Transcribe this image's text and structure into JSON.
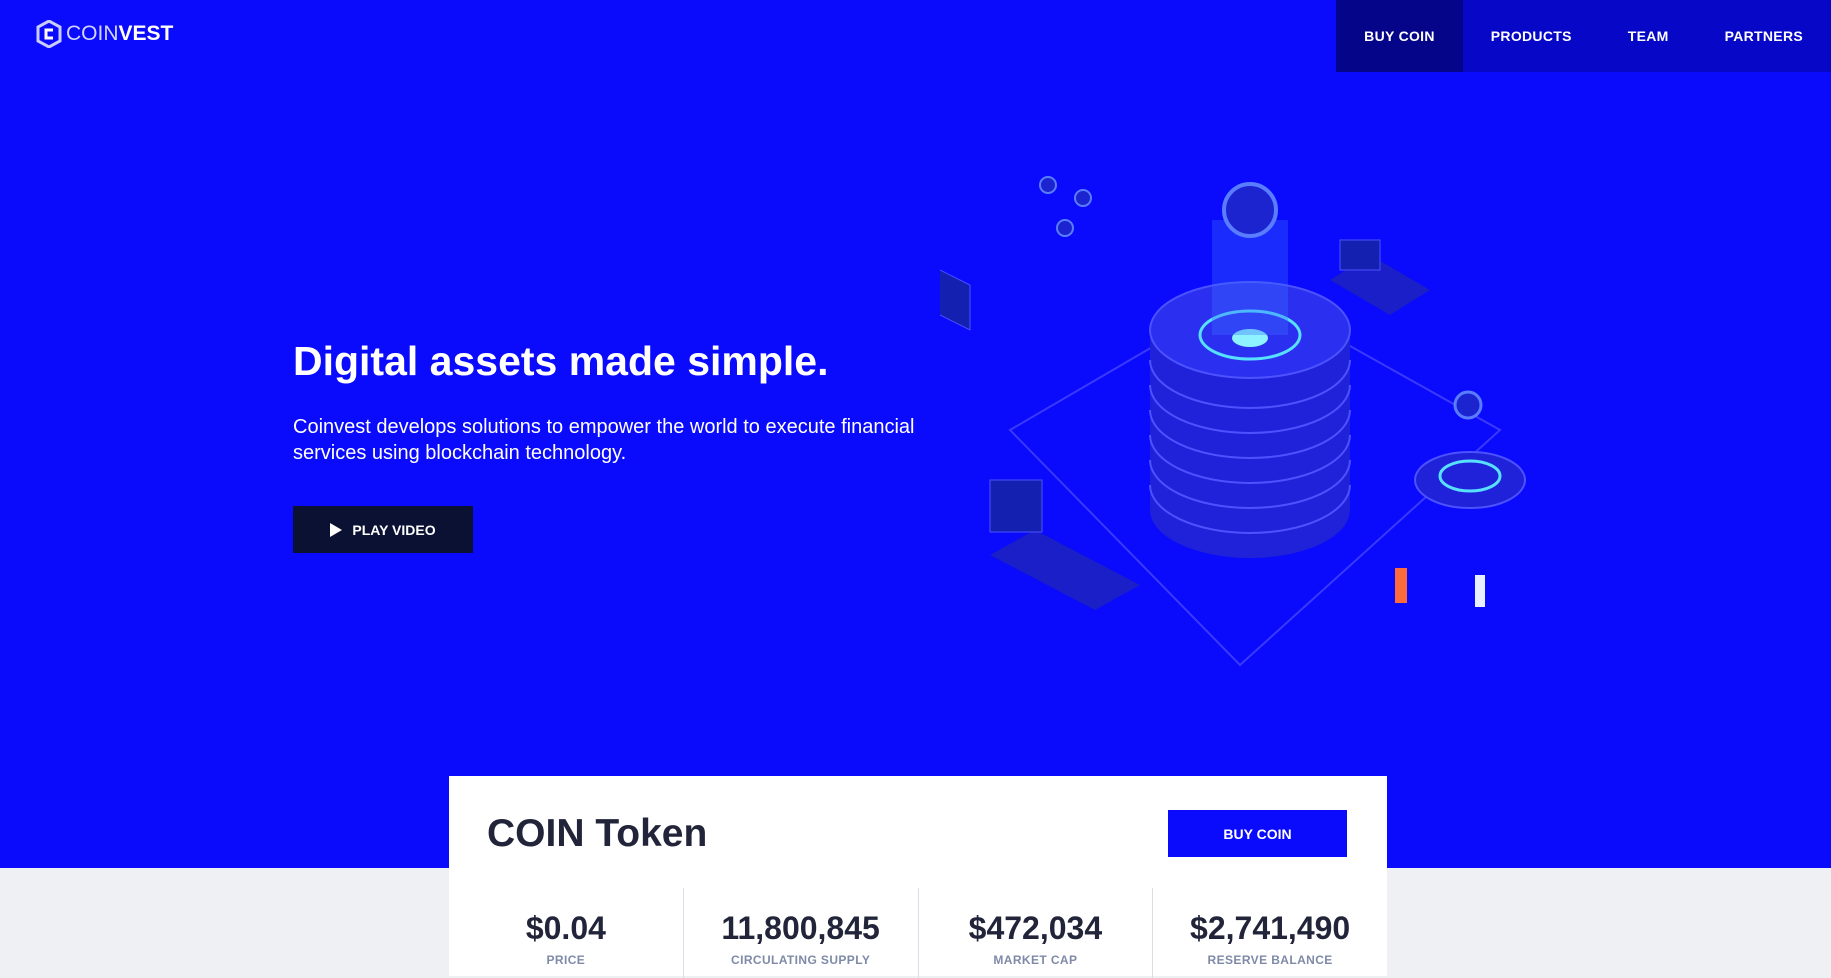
{
  "header": {
    "logo_light": "COIN",
    "logo_bold": "VEST",
    "nav": [
      "BUY COIN",
      "PRODUCTS",
      "TEAM",
      "PARTNERS"
    ]
  },
  "hero": {
    "title": "Digital assets made simple.",
    "subtitle": "Coinvest develops solutions to empower the world to execute financial services using blockchain technology.",
    "play_label": "PLAY VIDEO"
  },
  "token": {
    "title": "COIN Token",
    "buy_label": "BUY COIN",
    "stats": [
      {
        "value": "$0.04",
        "label": "PRICE"
      },
      {
        "value": "11,800,845",
        "label": "CIRCULATING SUPPLY"
      },
      {
        "value": "$472,034",
        "label": "MARKET CAP"
      },
      {
        "value": "$2,741,490",
        "label": "RESERVE BALANCE"
      }
    ]
  },
  "colors": {
    "brand": "#0a0afc",
    "dark": "#0b1133"
  }
}
